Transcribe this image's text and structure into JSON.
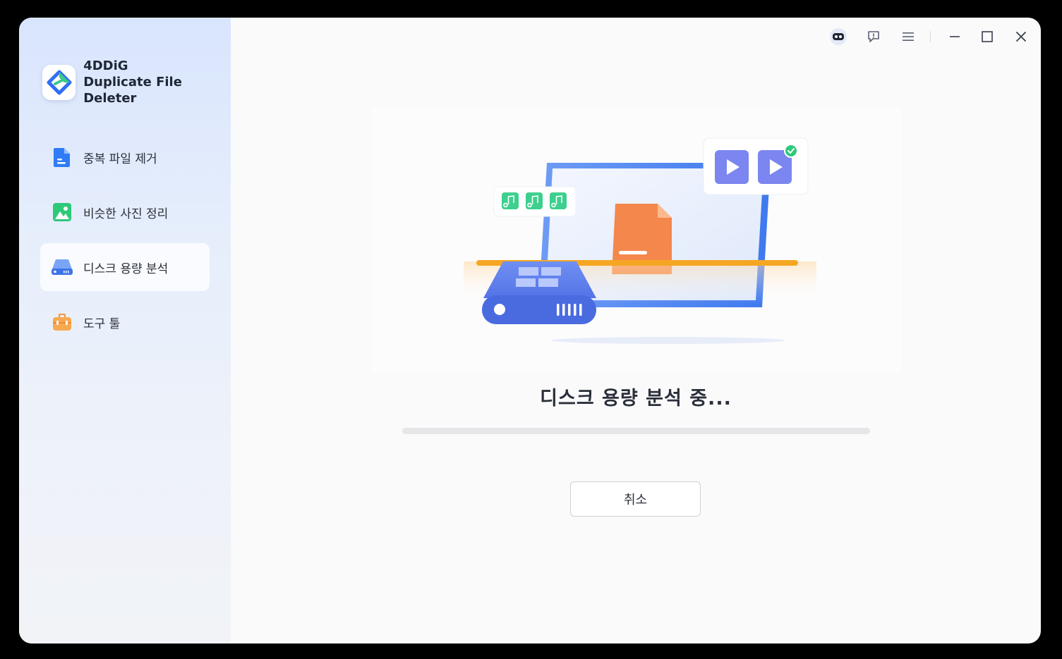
{
  "app": {
    "brand_line1": "4DDiG",
    "brand_line2": "Duplicate File Deleter"
  },
  "sidebar": {
    "items": [
      {
        "label": "중복 파일 제거",
        "icon": "document-icon",
        "active": false
      },
      {
        "label": "비슷한 사진 정리",
        "icon": "image-icon",
        "active": false
      },
      {
        "label": "디스크 용량 분석",
        "icon": "disk-drive-icon",
        "active": true
      },
      {
        "label": "도구 툴",
        "icon": "toolbox-icon",
        "active": false
      }
    ]
  },
  "titlebar": {
    "icons": [
      "assistant-bot-icon",
      "feedback-icon",
      "menu-icon",
      "minimize-icon",
      "maximize-icon",
      "close-icon"
    ]
  },
  "main": {
    "status_title": "디스크 용량 분석 중...",
    "progress": 0,
    "cancel_label": "취소"
  },
  "colors": {
    "accent": "#3b82f6",
    "sidebar_top": "#d9e5fd",
    "scan_line": "#f5a623",
    "document_orange": "#f4874b",
    "music_green": "#3ecf8e",
    "video_purple": "#7b86f0"
  }
}
